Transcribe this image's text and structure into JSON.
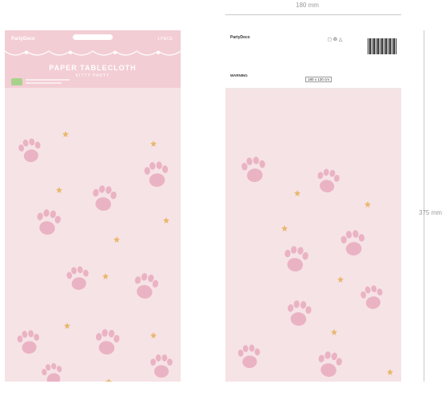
{
  "dimensions": {
    "width_label": "180 mm",
    "height_label": "375 mm"
  },
  "front": {
    "brand": "PartyDeco",
    "pieces": "1 PIECE",
    "title": "PAPER TABLECLOTH",
    "subtitle": "KITTY PARTY"
  },
  "back": {
    "brand": "PartyDeco",
    "warning": "WARNING",
    "size": "180 x 120 cm"
  },
  "colors": {
    "pink": "#f3cdd4",
    "paw": "#eab3c4",
    "star": "#e8b86e"
  }
}
